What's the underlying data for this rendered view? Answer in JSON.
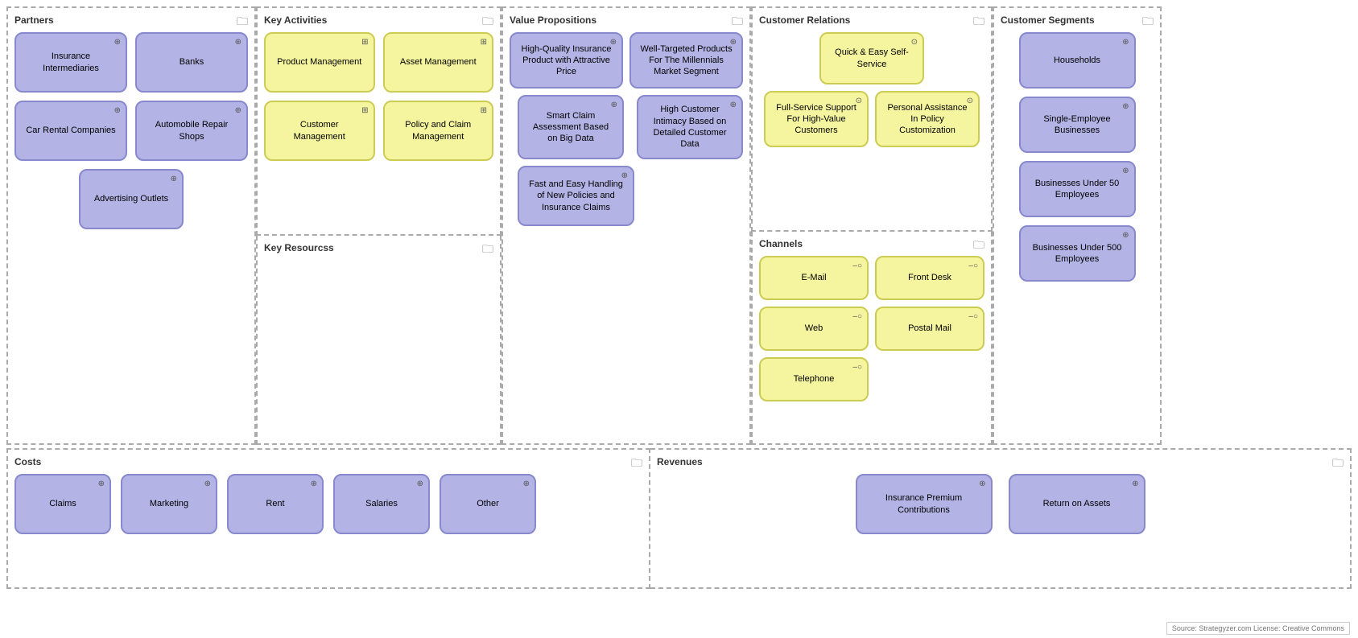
{
  "sections": {
    "partners": {
      "title": "Partners",
      "cards": [
        {
          "label": "Insurance Intermediaries",
          "type": "purple",
          "icon": "link"
        },
        {
          "label": "Banks",
          "type": "purple",
          "icon": "link"
        },
        {
          "label": "Car Rental Companies",
          "type": "purple",
          "icon": "link"
        },
        {
          "label": "Automobile Repair Shops",
          "type": "purple",
          "icon": "link"
        },
        {
          "label": "Advertising Outlets",
          "type": "purple",
          "icon": "link"
        }
      ]
    },
    "activities": {
      "title": "Key Activities",
      "cards": [
        {
          "label": "Product Management",
          "type": "yellow",
          "icon": "grid"
        },
        {
          "label": "Asset Management",
          "type": "yellow",
          "icon": "grid"
        },
        {
          "label": "Customer Management",
          "type": "yellow",
          "icon": "grid"
        },
        {
          "label": "Policy and Claim Management",
          "type": "yellow",
          "icon": "grid"
        }
      ]
    },
    "resources": {
      "title": "Key Resourcss"
    },
    "value": {
      "title": "Value Propositions",
      "cards": [
        {
          "label": "High-Quality Insurance Product with Attractive Price",
          "type": "purple",
          "icon": "link"
        },
        {
          "label": "Well-Targeted Products For The Millennials Market Segment",
          "type": "purple",
          "icon": "link"
        },
        {
          "label": "Smart Claim Assessment Based on Big Data",
          "type": "purple",
          "icon": "link"
        },
        {
          "label": "High Customer Intimacy Based on Detailed Customer Data",
          "type": "purple",
          "icon": "link"
        },
        {
          "label": "Fast and Easy Handling of New Policies and Insurance Claims",
          "type": "purple",
          "icon": "link"
        }
      ]
    },
    "relations": {
      "title": "Customer Relations",
      "cards": [
        {
          "label": "Quick & Easy Self-Service",
          "type": "yellow",
          "icon": "settings"
        },
        {
          "label": "Full-Service Support For High-Value Customers",
          "type": "yellow",
          "icon": "settings"
        },
        {
          "label": "Personal Assistance In Policy Customization",
          "type": "yellow",
          "icon": "settings"
        }
      ]
    },
    "channels": {
      "title": "Channels",
      "cards": [
        {
          "label": "E-Mail",
          "type": "yellow",
          "icon": "minus-circle"
        },
        {
          "label": "Front Desk",
          "type": "yellow",
          "icon": "minus-circle"
        },
        {
          "label": "Web",
          "type": "yellow",
          "icon": "minus-circle"
        },
        {
          "label": "Postal Mail",
          "type": "yellow",
          "icon": "minus-circle"
        },
        {
          "label": "Telephone",
          "type": "yellow",
          "icon": "minus-circle"
        }
      ]
    },
    "segments": {
      "title": "Customer Segments",
      "cards": [
        {
          "label": "Households",
          "type": "purple",
          "icon": "link"
        },
        {
          "label": "Single-Employee Businesses",
          "type": "purple",
          "icon": "link"
        },
        {
          "label": "Businesses Under 50 Employees",
          "type": "purple",
          "icon": "link"
        },
        {
          "label": "Businesses Under 500 Employees",
          "type": "purple",
          "icon": "link"
        }
      ]
    },
    "costs": {
      "title": "Costs",
      "cards": [
        {
          "label": "Claims",
          "type": "purple",
          "icon": "link"
        },
        {
          "label": "Marketing",
          "type": "purple",
          "icon": "link"
        },
        {
          "label": "Rent",
          "type": "purple",
          "icon": "link"
        },
        {
          "label": "Salaries",
          "type": "purple",
          "icon": "link"
        },
        {
          "label": "Other",
          "type": "purple",
          "icon": "link"
        }
      ]
    },
    "revenues": {
      "title": "Revenues",
      "cards": [
        {
          "label": "Insurance Premium Contributions",
          "type": "purple",
          "icon": "link"
        },
        {
          "label": "Return on Assets",
          "type": "purple",
          "icon": "link"
        }
      ]
    }
  },
  "source": "Source: Strategyzer.com License: Creative Commons",
  "icons": {
    "folder": "🗀",
    "link": "⊕",
    "grid": "⊞",
    "settings": "⊙",
    "minus_circle": "–○"
  }
}
